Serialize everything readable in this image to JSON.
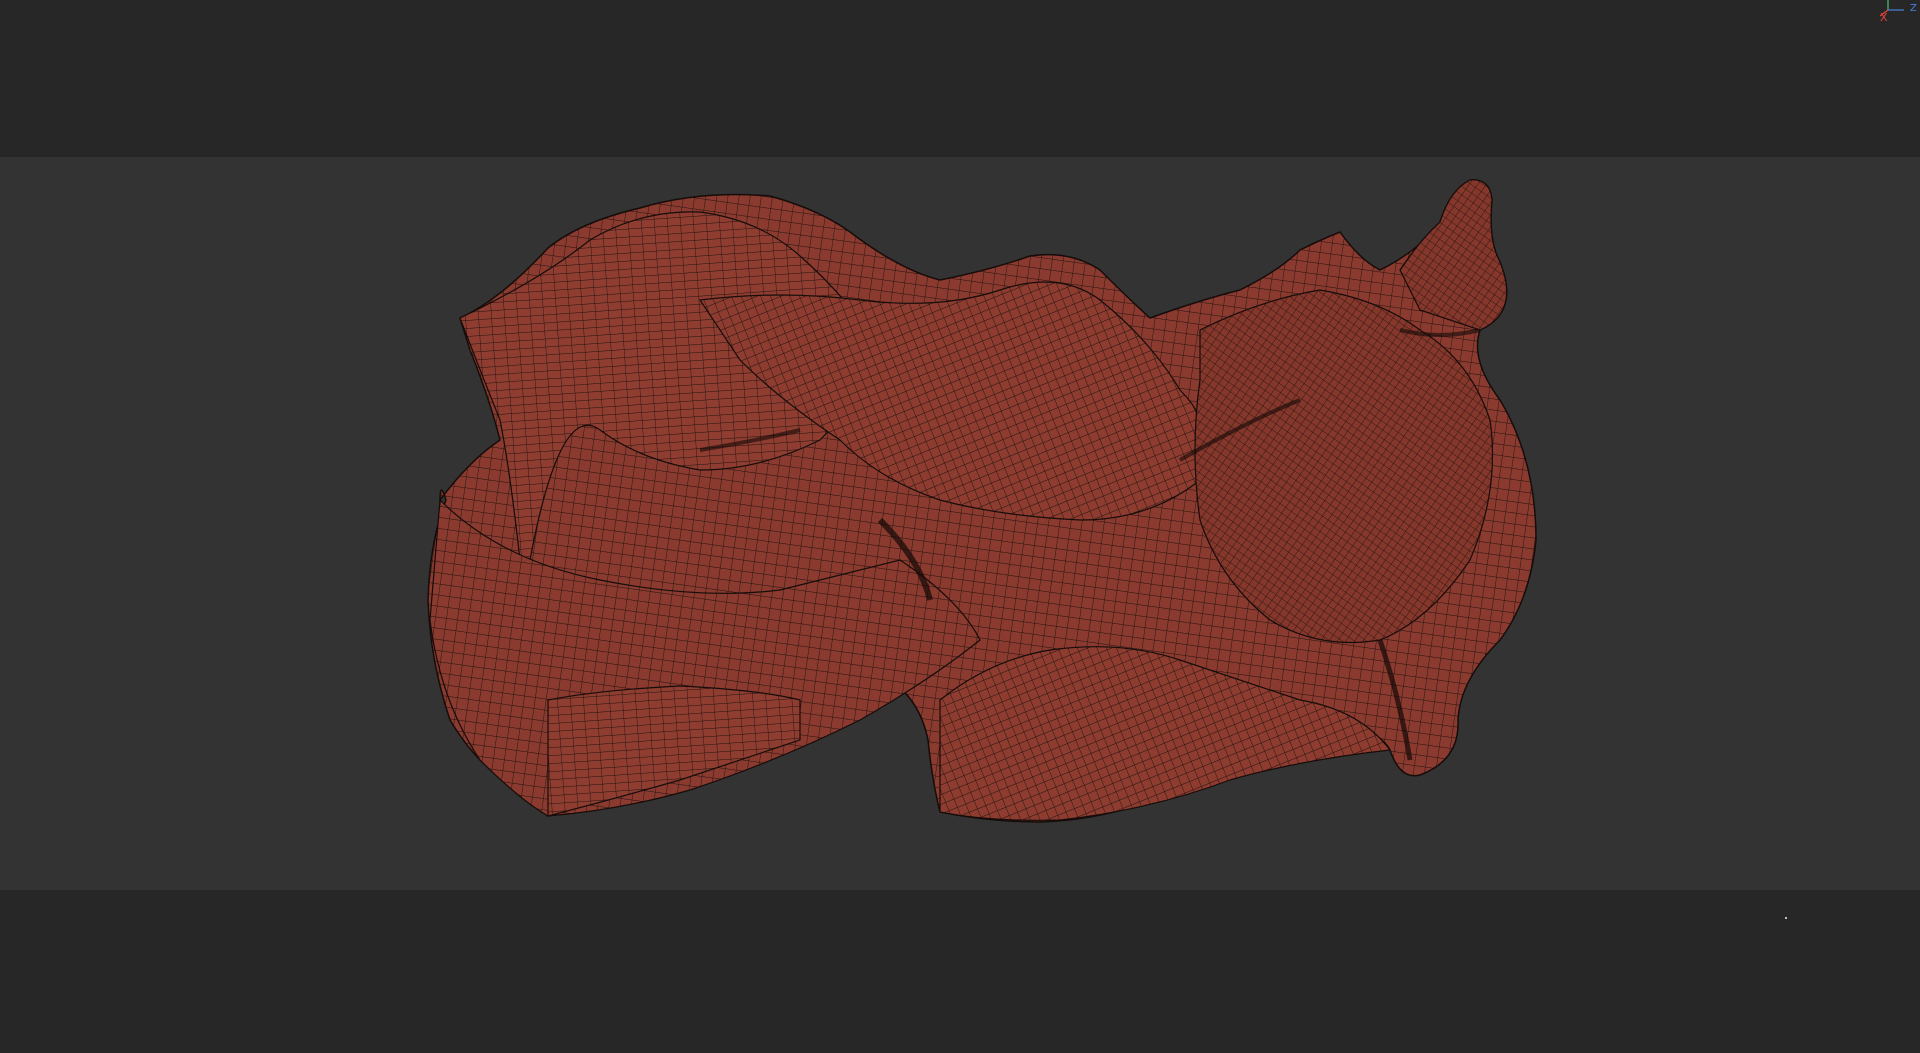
{
  "viewport": {
    "background_color": "#272727",
    "frame_color": "#333333"
  },
  "mesh": {
    "fill_color": "#8a3a2e",
    "wire_color": "#1a0f0d",
    "display_mode": "wireframe-on-shaded"
  },
  "gizmo": {
    "x_label": "X",
    "z_label": "Z",
    "x_color": "#e0453c",
    "z_color": "#4a7fe0",
    "y_color": "#4fbf6a"
  },
  "status": {
    "indicator_color": "#bfbfbf"
  }
}
